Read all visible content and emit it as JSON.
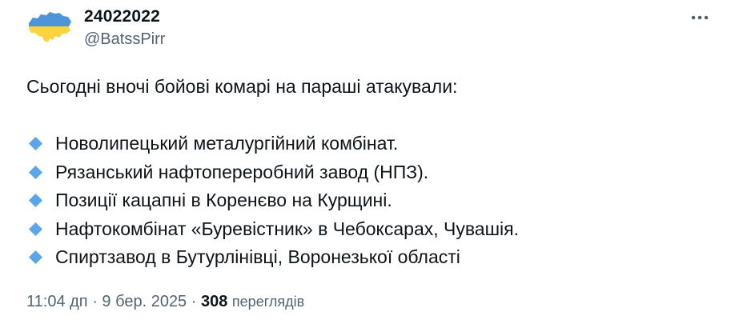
{
  "author": {
    "display_name": "24022022",
    "handle": "@BatssPirr",
    "avatar_icon": "ukraine-map-icon",
    "avatar_colors": {
      "top": "#4d94d9",
      "bottom": "#ffd23f"
    }
  },
  "more_icon": "more-options-icon",
  "tweet": {
    "intro": "Сьогодні вночі бойові комарі на параші атакували:",
    "bullet_icon": "small-blue-diamond-icon",
    "bullet_color": "#5aa6e8",
    "items": [
      {
        "text": "Новолипецький металургійний комбінат."
      },
      {
        "text": "Рязанський нафтопереробний завод (НПЗ)."
      },
      {
        "text": "Позиції кацапні в Коренєво на Курщині."
      },
      {
        "text": "Нафтокомбінат «Буревістник» в Чебоксарах, Чувашія."
      },
      {
        "text": "Спиртзавод в Бутурлінівці, Воронезької області"
      }
    ]
  },
  "meta": {
    "time": "11:04 дп",
    "separator": "·",
    "date": "9 бер. 2025",
    "views_count": "308",
    "views_label": "переглядів"
  }
}
